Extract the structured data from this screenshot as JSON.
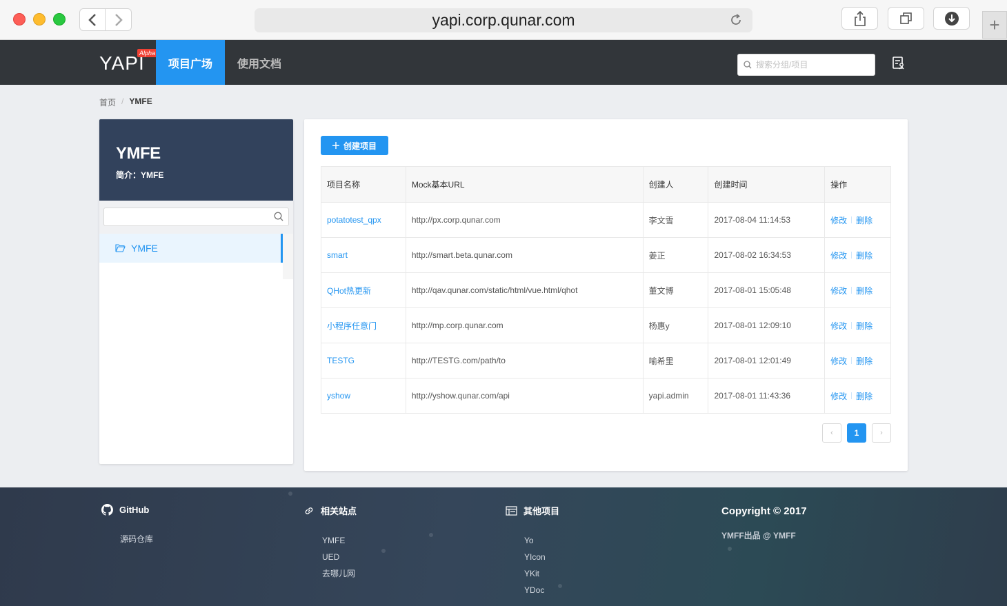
{
  "browser": {
    "url": "yapi.corp.qunar.com"
  },
  "header": {
    "logo": "YAPI",
    "badge": "Alpha",
    "nav": [
      {
        "label": "项目广场",
        "active": true
      },
      {
        "label": "使用文档",
        "active": false
      }
    ],
    "search": {
      "placeholder": "搜索分组/项目",
      "value": ""
    }
  },
  "breadcrumb": {
    "home": "首页",
    "separator": "/",
    "current": "YMFE"
  },
  "sidebar": {
    "title": "YMFE",
    "description": "简介：YMFE",
    "search": {
      "value": "",
      "placeholder": ""
    },
    "groups": [
      {
        "label": "YMFE",
        "selected": true
      }
    ]
  },
  "main": {
    "create_button": "创建项目",
    "columns": [
      "项目名称",
      "Mock基本URL",
      "创建人",
      "创建时间",
      "操作"
    ],
    "rows": [
      {
        "name": "potatotest_qpx",
        "url": "http://px.corp.qunar.com",
        "creator": "李文雪",
        "time": "2017-08-04 11:14:53",
        "edit": "修改",
        "del": "删除"
      },
      {
        "name": "smart",
        "url": "http://smart.beta.qunar.com",
        "creator": "姜正",
        "time": "2017-08-02 16:34:53",
        "edit": "修改",
        "del": "删除"
      },
      {
        "name": "QHot热更新",
        "url": "http://qav.qunar.com/static/html/vue.html/qhot",
        "creator": "董文博",
        "time": "2017-08-01 15:05:48",
        "edit": "修改",
        "del": "删除"
      },
      {
        "name": "小程序任意门",
        "url": "http://mp.corp.qunar.com",
        "creator": "杨惠y",
        "time": "2017-08-01 12:09:10",
        "edit": "修改",
        "del": "删除"
      },
      {
        "name": "TESTG",
        "url": "http://TESTG.com/path/to",
        "creator": "喻希里",
        "time": "2017-08-01 12:01:49",
        "edit": "修改",
        "del": "删除"
      },
      {
        "name": "yshow",
        "url": "http://yshow.qunar.com/api",
        "creator": "yapi.admin",
        "time": "2017-08-01 11:43:36",
        "edit": "修改",
        "del": "删除"
      }
    ],
    "pagination": {
      "prev": "‹",
      "current": "1",
      "next": "›"
    }
  },
  "footer": {
    "github": {
      "title": "GitHub",
      "links": [
        "源码仓库"
      ]
    },
    "related": {
      "title": "相关站点",
      "links": [
        "YMFE",
        "UED",
        "去哪儿网"
      ]
    },
    "other": {
      "title": "其他项目",
      "links": [
        "Yo",
        "YIcon",
        "YKit",
        "YDoc"
      ]
    },
    "copyright": "Copyright © 2017",
    "credit": "YMFF出品 @ YMFF"
  },
  "colors": {
    "primary": "#2395f1",
    "header_bg": "#32363a",
    "sidebar_head": "#32425c"
  }
}
